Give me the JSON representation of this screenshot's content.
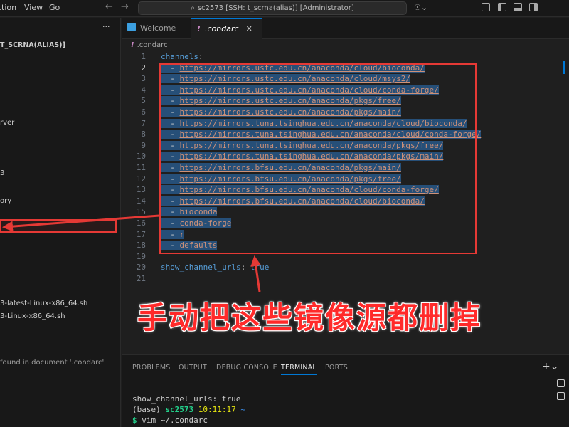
{
  "titlebar": {
    "menu": [
      "ction",
      "View",
      "Go"
    ],
    "back_arrow": "←",
    "forward_arrow": "→",
    "command_center": "sc2573 [SSH: t_scrna(alias)] [Administrator]",
    "search_glyph": "⌕",
    "copilot_glyph": "☉⌄"
  },
  "sidebar": {
    "more_actions": "···",
    "items": [
      {
        "label": "T_SCRNA(ALIAS)]",
        "bold": true
      },
      {
        "label": "rver"
      },
      {
        "label": "3"
      },
      {
        "label": "ory"
      },
      {
        "label": "3-latest-Linux-x86_64.sh"
      },
      {
        "label": "3-Linux-x86_64.sh"
      },
      {
        "label": "found in document '.condarc'"
      }
    ]
  },
  "tabs": [
    {
      "label": "Welcome",
      "active": false
    },
    {
      "label": ".condarc",
      "active": true,
      "close": "✕"
    }
  ],
  "breadcrumb": {
    "icon": "!",
    "label": ".condarc"
  },
  "editor": {
    "lines": [
      {
        "n": "1",
        "key": "channels",
        "colon": ":"
      },
      {
        "n": "2",
        "dash": "- ",
        "url": "https://mirrors.ustc.edu.cn/anaconda/cloud/bioconda/"
      },
      {
        "n": "3",
        "dash": "- ",
        "url": "https://mirrors.ustc.edu.cn/anaconda/cloud/msys2/"
      },
      {
        "n": "4",
        "dash": "- ",
        "url": "https://mirrors.ustc.edu.cn/anaconda/cloud/conda-forge/"
      },
      {
        "n": "5",
        "dash": "- ",
        "url": "https://mirrors.ustc.edu.cn/anaconda/pkgs/free/"
      },
      {
        "n": "6",
        "dash": "- ",
        "url": "https://mirrors.ustc.edu.cn/anaconda/pkgs/main/"
      },
      {
        "n": "7",
        "dash": "- ",
        "url": "https://mirrors.tuna.tsinghua.edu.cn/anaconda/cloud/bioconda/"
      },
      {
        "n": "8",
        "dash": "- ",
        "url": "https://mirrors.tuna.tsinghua.edu.cn/anaconda/cloud/conda-forge/"
      },
      {
        "n": "9",
        "dash": "- ",
        "url": "https://mirrors.tuna.tsinghua.edu.cn/anaconda/pkgs/free/"
      },
      {
        "n": "10",
        "dash": "- ",
        "url": "https://mirrors.tuna.tsinghua.edu.cn/anaconda/pkgs/main/"
      },
      {
        "n": "11",
        "dash": "- ",
        "url": "https://mirrors.bfsu.edu.cn/anaconda/pkgs/main/"
      },
      {
        "n": "12",
        "dash": "- ",
        "url": "https://mirrors.bfsu.edu.cn/anaconda/pkgs/free/"
      },
      {
        "n": "13",
        "dash": "- ",
        "url": "https://mirrors.bfsu.edu.cn/anaconda/cloud/conda-forge/"
      },
      {
        "n": "14",
        "dash": "- ",
        "url": "https://mirrors.bfsu.edu.cn/anaconda/cloud/bioconda/"
      },
      {
        "n": "15",
        "dash": "- ",
        "str": "bioconda"
      },
      {
        "n": "16",
        "dash": "- ",
        "str": "conda-forge"
      },
      {
        "n": "17",
        "dash": "- ",
        "str": "r"
      },
      {
        "n": "18",
        "dash": "- ",
        "str": "defaults"
      },
      {
        "n": "19"
      },
      {
        "n": "20",
        "key": "show_channel_urls",
        "colon": ": ",
        "bool": "true"
      },
      {
        "n": "21"
      }
    ],
    "bulb_glyph": "✦-"
  },
  "annotation": {
    "caption": "手动把这些镜像源都删掉",
    "color": "#e53935"
  },
  "panel": {
    "tabs": [
      "PROBLEMS",
      "OUTPUT",
      "DEBUG CONSOLE",
      "TERMINAL",
      "PORTS"
    ],
    "active_tab": "TERMINAL",
    "add_glyph": "+⌄",
    "terminal": {
      "line1": "show_channel_urls: true",
      "prompt_env": "(base) ",
      "prompt_host": "sc2573",
      "prompt_time": " 10:11:17",
      "prompt_tilde": " ~",
      "prompt_symbol": "$ ",
      "command": "vim ~/.condarc"
    }
  }
}
